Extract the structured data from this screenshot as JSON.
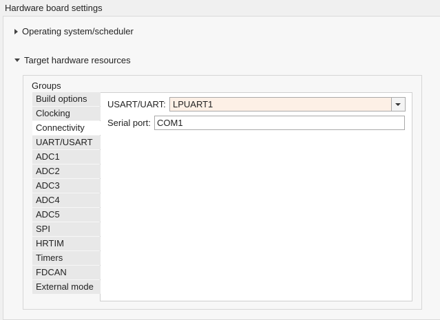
{
  "header": {
    "title": "Hardware board settings"
  },
  "sections": [
    {
      "label": "Operating system/scheduler",
      "expanded": false
    },
    {
      "label": "Target hardware resources",
      "expanded": true
    }
  ],
  "groups": {
    "label": "Groups",
    "selected": "Connectivity",
    "items": [
      "Build options",
      "Clocking",
      "Connectivity",
      "UART/USART",
      "ADC1",
      "ADC2",
      "ADC3",
      "ADC4",
      "ADC5",
      "SPI",
      "HRTIM",
      "Timers",
      "FDCAN",
      "External mode"
    ]
  },
  "connectivity": {
    "usart_label": "USART/UART:",
    "usart_value": "LPUART1",
    "serial_port_label": "Serial port:",
    "serial_port_value": "COM1"
  },
  "colors": {
    "dropdown_highlight": "#fdf0e6",
    "selected_group_bg": "#ffffff",
    "group_bg": "#e8e8e8"
  }
}
